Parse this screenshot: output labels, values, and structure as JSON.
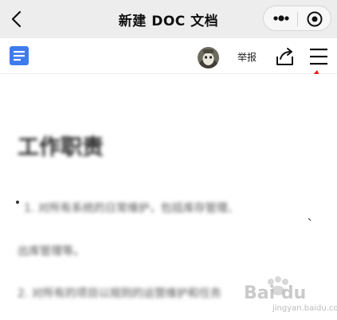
{
  "nav": {
    "title": "新建 DOC 文档"
  },
  "toolbar": {
    "report_label": "举报"
  },
  "document": {
    "heading": "工作职责",
    "paragraphs": [
      "1. 对所有系统的日常维护，包括库存管理、",
      "出库管理等。",
      "2. 对所有的项目以规则的运营维护和任务"
    ],
    "trailing_mark": "、"
  },
  "watermark": {
    "text": "Bai du",
    "sub": "jingyan.baidu.com"
  },
  "colors": {
    "nav_bg": "#ededed",
    "doc_icon_blue": "#3e7bf0",
    "arrow_red": "#e8221b"
  }
}
